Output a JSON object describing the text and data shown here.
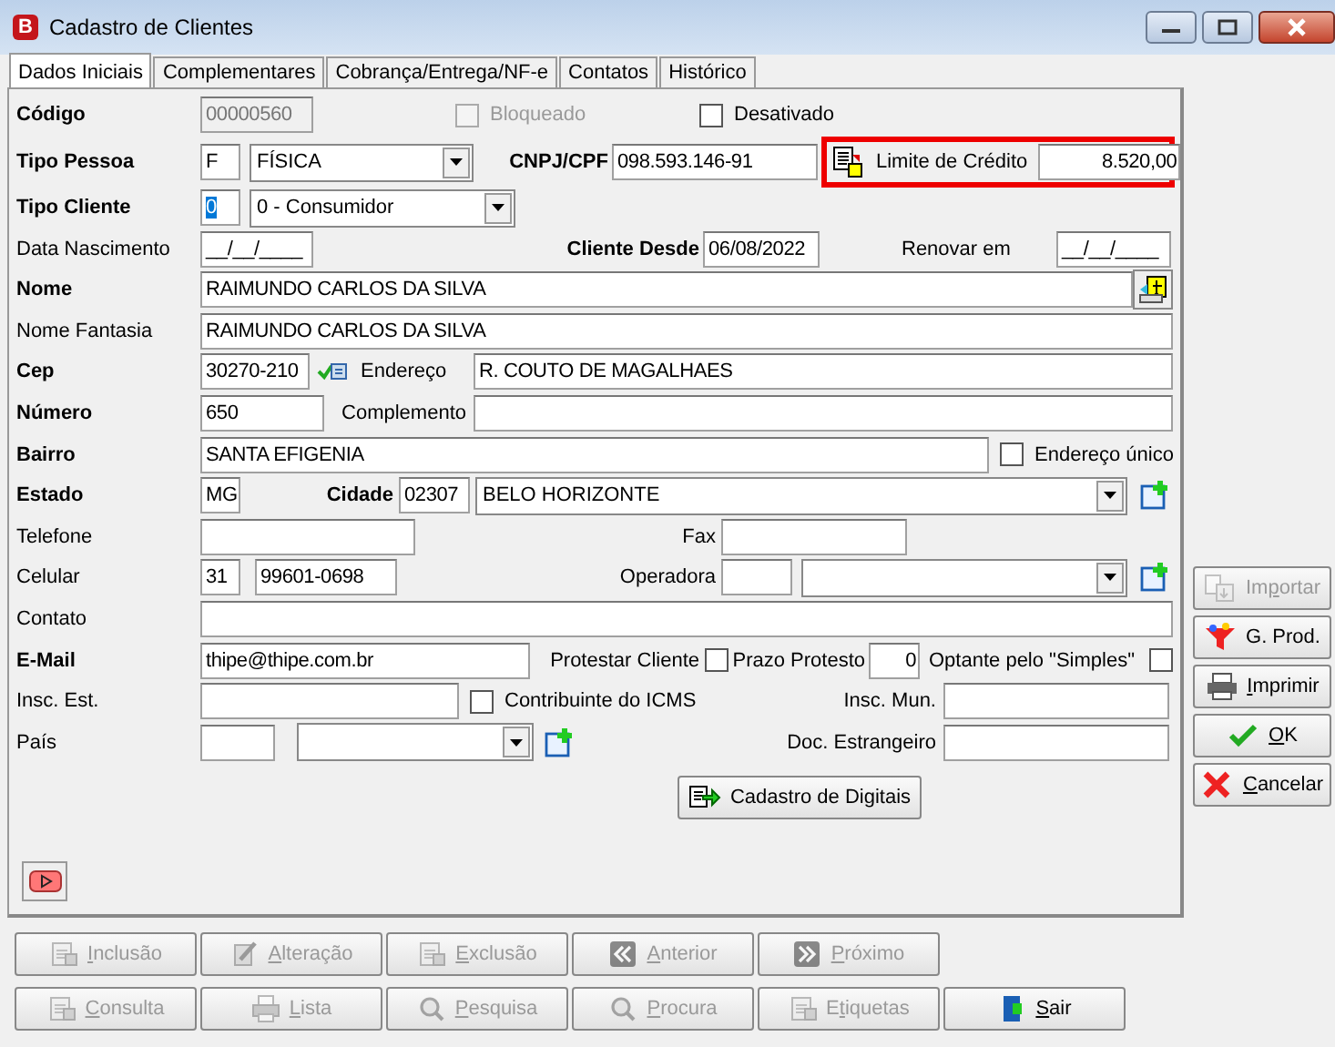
{
  "window": {
    "app_icon": "B",
    "title": "Cadastro de Clientes"
  },
  "tabs": [
    {
      "label": "Dados Iniciais",
      "selected": true
    },
    {
      "label": "Complementares",
      "selected": false
    },
    {
      "label": "Cobrança/Entrega/NF-e",
      "selected": false
    },
    {
      "label": "Contatos",
      "selected": false
    },
    {
      "label": "Histórico",
      "selected": false
    }
  ],
  "rows": [
    {
      "items": [
        {
          "kind": "label",
          "text": "Código",
          "required": true
        },
        {
          "kind": "field",
          "value": "00000560",
          "disabled": true
        },
        {
          "kind": "checkbox",
          "label": "Bloqueado",
          "checked": false,
          "disabled": true
        },
        {
          "kind": "checkbox",
          "label": "Desativado",
          "checked": false,
          "disabled": false
        }
      ]
    },
    {
      "items": [
        {
          "kind": "label",
          "text": "Tipo Pessoa",
          "required": true
        },
        {
          "kind": "field",
          "value": "F"
        },
        {
          "kind": "combo",
          "value": "FÍSICA"
        },
        {
          "kind": "label",
          "text": "CNPJ/CPF",
          "required": true
        },
        {
          "kind": "field",
          "value": "098.593.146-91"
        },
        {
          "kind": "group",
          "highlighted": true,
          "items": [
            {
              "kind": "credit-icon"
            },
            {
              "kind": "label",
              "text": "Limite de Crédito",
              "required": false
            },
            {
              "kind": "field",
              "value": "8.520,00"
            }
          ]
        }
      ]
    },
    {
      "items": [
        {
          "kind": "label",
          "text": "Tipo Cliente",
          "required": true
        },
        {
          "kind": "field",
          "value": "0",
          "text_selected": true
        },
        {
          "kind": "combo",
          "value": "0 - Consumidor"
        }
      ]
    },
    {
      "items": [
        {
          "kind": "label",
          "text": "Data Nascimento",
          "required": false
        },
        {
          "kind": "field",
          "value": "__/__/____"
        },
        {
          "kind": "label",
          "text": "Cliente Desde",
          "required": true
        },
        {
          "kind": "field",
          "value": "06/08/2022"
        },
        {
          "kind": "label",
          "text": "Renovar em",
          "required": false
        },
        {
          "kind": "field",
          "value": "__/__/____"
        }
      ]
    },
    {
      "items": [
        {
          "kind": "label",
          "text": "Nome",
          "required": true
        },
        {
          "kind": "field",
          "value": "RAIMUNDO CARLOS DA SILVA"
        },
        {
          "kind": "photo-button"
        }
      ]
    },
    {
      "items": [
        {
          "kind": "label",
          "text": "Nome Fantasia",
          "required": false
        },
        {
          "kind": "field",
          "value": "RAIMUNDO CARLOS DA SILVA"
        }
      ]
    },
    {
      "items": [
        {
          "kind": "label",
          "text": "Cep",
          "required": true
        },
        {
          "kind": "field",
          "value": "30270-210"
        },
        {
          "kind": "lookup-button"
        },
        {
          "kind": "label",
          "text": "Endereço",
          "required": false
        },
        {
          "kind": "field",
          "value": "R. COUTO DE MAGALHAES"
        }
      ]
    },
    {
      "items": [
        {
          "kind": "label",
          "text": "Número",
          "required": true
        },
        {
          "kind": "field",
          "value": "650"
        },
        {
          "kind": "label",
          "text": "Complemento",
          "required": false
        },
        {
          "kind": "field"
        }
      ]
    },
    {
      "items": [
        {
          "kind": "label",
          "text": "Bairro",
          "required": true
        },
        {
          "kind": "field",
          "value": "SANTA EFIGENIA"
        },
        {
          "kind": "checkbox",
          "label": "Endereço único",
          "checked": false,
          "disabled": false
        }
      ]
    },
    {
      "items": [
        {
          "kind": "label",
          "text": "Estado",
          "required": true
        },
        {
          "kind": "field",
          "value": "MG"
        },
        {
          "kind": "label",
          "text": "Cidade",
          "required": true
        },
        {
          "kind": "field",
          "value": "02307"
        },
        {
          "kind": "combo",
          "value": "BELO HORIZONTE"
        },
        {
          "kind": "add-button"
        }
      ]
    },
    {
      "items": [
        {
          "kind": "label",
          "text": "Telefone",
          "required": false
        },
        {
          "kind": "field"
        },
        {
          "kind": "label",
          "text": "Fax",
          "required": false
        },
        {
          "kind": "field"
        }
      ]
    },
    {
      "items": [
        {
          "kind": "label",
          "text": "Celular",
          "required": false
        },
        {
          "kind": "field",
          "value": "31"
        },
        {
          "kind": "field",
          "value": "99601-0698"
        },
        {
          "kind": "label",
          "text": "Operadora",
          "required": false
        },
        {
          "kind": "field"
        },
        {
          "kind": "combo"
        },
        {
          "kind": "add-button"
        }
      ]
    },
    {
      "items": [
        {
          "kind": "label",
          "text": "Contato",
          "required": false
        },
        {
          "kind": "field"
        }
      ]
    },
    {
      "items": [
        {
          "kind": "label",
          "text": "E-Mail",
          "required": true
        },
        {
          "kind": "field",
          "value": "thipe@thipe.com.br"
        },
        {
          "kind": "label",
          "text": "Protestar Cliente",
          "required": false
        },
        {
          "kind": "checkbox",
          "checked": false,
          "disabled": false
        },
        {
          "kind": "label",
          "text": "Prazo Protesto",
          "required": false
        },
        {
          "kind": "field",
          "value": "0"
        },
        {
          "kind": "label",
          "text": "Optante pelo \"Simples\"",
          "required": false
        },
        {
          "kind": "checkbox",
          "checked": false,
          "disabled": false
        }
      ]
    },
    {
      "items": [
        {
          "kind": "label",
          "text": "Insc. Est.",
          "required": false
        },
        {
          "kind": "field"
        },
        {
          "kind": "checkbox",
          "label": "Contribuinte do ICMS",
          "checked": false,
          "disabled": false
        },
        {
          "kind": "label",
          "text": "Insc. Mun.",
          "required": false
        },
        {
          "kind": "field"
        }
      ]
    },
    {
      "items": [
        {
          "kind": "label",
          "text": "País",
          "required": false
        },
        {
          "kind": "field"
        },
        {
          "kind": "combo"
        },
        {
          "kind": "add-button"
        },
        {
          "kind": "label",
          "text": "Doc. Estrangeiro",
          "required": false
        },
        {
          "kind": "field"
        }
      ]
    }
  ],
  "digitais_button": {
    "label": "Cadastro de Digitais"
  },
  "side_buttons": [
    {
      "pre": "Im",
      "key": "p",
      "post": "ortar",
      "disabled": true
    },
    {
      "pre": "G. Prod.",
      "disabled": false
    },
    {
      "key": "I",
      "post": "mprimir",
      "disabled": false
    },
    {
      "key": "O",
      "post": "K",
      "disabled": false
    },
    {
      "key": "C",
      "post": "ancelar",
      "disabled": false
    }
  ],
  "nav_buttons": [
    {
      "key": "I",
      "post": "nclusão",
      "disabled": true
    },
    {
      "key": "A",
      "post": "lteração",
      "disabled": true
    },
    {
      "key": "E",
      "post": "xclusão",
      "disabled": true
    },
    {
      "key": "A",
      "post": "nterior",
      "disabled": true
    },
    {
      "key": "P",
      "post": "róximo",
      "disabled": true
    },
    {
      "key": "C",
      "post": "onsulta",
      "disabled": true
    },
    {
      "key": "L",
      "post": "ista",
      "disabled": true
    },
    {
      "key": "P",
      "post": "esquisa",
      "disabled": true
    },
    {
      "key": "P",
      "post": "rocura",
      "disabled": true
    },
    {
      "pre": "E",
      "key": "t",
      "post": "iquetas",
      "disabled": true
    },
    {
      "key": "S",
      "post": "air",
      "disabled": false
    }
  ]
}
